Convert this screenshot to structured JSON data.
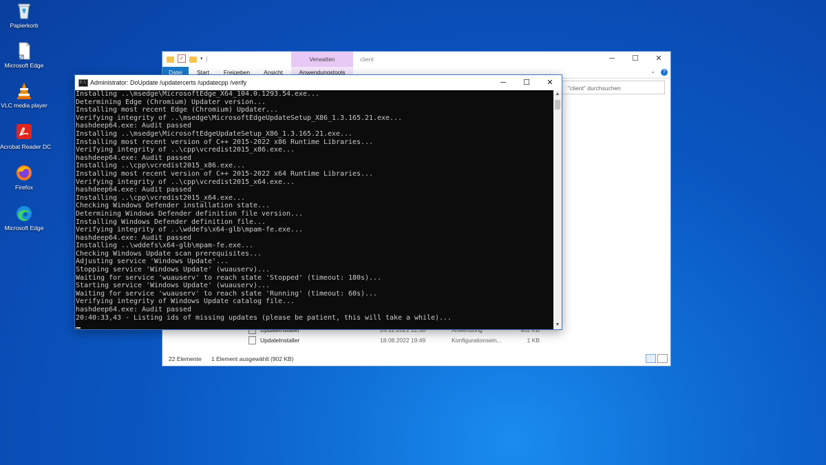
{
  "desktop": {
    "icons": [
      {
        "label": "Papierkorb",
        "icon": "recycle-bin-icon"
      },
      {
        "label": "Microsoft Edge",
        "icon": "file-shortcut-icon"
      },
      {
        "label": "VLC media player",
        "icon": "vlc-icon"
      },
      {
        "label": "Acrobat Reader DC",
        "icon": "acrobat-icon"
      },
      {
        "label": "Firefox",
        "icon": "firefox-icon"
      },
      {
        "label": "Microsoft Edge",
        "icon": "edge-icon"
      }
    ]
  },
  "explorer": {
    "context_tab": "Verwalten",
    "title": "client",
    "ribbon_tabs": [
      "Datei",
      "Start",
      "Freigeben",
      "Ansicht",
      "Anwendungstools"
    ],
    "search_placeholder": "\"client\" durchsuchen",
    "files": [
      {
        "name": "UpdateInstaller",
        "date": "24.12.2021 12:30",
        "type": "Anwendung",
        "size": "902 KB"
      },
      {
        "name": "UpdateInstaller",
        "date": "18.08.2022 19:49",
        "type": "Konfigurationsein...",
        "size": "1 KB"
      }
    ],
    "status_count": "22 Elemente",
    "status_selected": "1 Element ausgewählt (902 KB)"
  },
  "console": {
    "title": "Administrator:  DoUpdate /updatercerts /updatecpp /verify",
    "lines": [
      "Installing ..\\msedge\\MicrosoftEdge_X64_104.0.1293.54.exe...",
      "Determining Edge (Chromium) Updater version...",
      "Installing most recent Edge (Chromium) Updater...",
      "Verifying integrity of ..\\msedge\\MicrosoftEdgeUpdateSetup_X86_1.3.165.21.exe...",
      "hashdeep64.exe: Audit passed",
      "Installing ..\\msedge\\MicrosoftEdgeUpdateSetup_X86_1.3.165.21.exe...",
      "Installing most recent version of C++ 2015-2022 x86 Runtime Libraries...",
      "Verifying integrity of ..\\cpp\\vcredist2015_x86.exe...",
      "hashdeep64.exe: Audit passed",
      "Installing ..\\cpp\\vcredist2015_x86.exe...",
      "Installing most recent version of C++ 2015-2022 x64 Runtime Libraries...",
      "Verifying integrity of ..\\cpp\\vcredist2015_x64.exe...",
      "hashdeep64.exe: Audit passed",
      "Installing ..\\cpp\\vcredist2015_x64.exe...",
      "Checking Windows Defender installation state...",
      "Determining Windows Defender definition file version...",
      "Installing Windows Defender definition file...",
      "Verifying integrity of ..\\wddefs\\x64-glb\\mpam-fe.exe...",
      "hashdeep64.exe: Audit passed",
      "Installing ..\\wddefs\\x64-glb\\mpam-fe.exe...",
      "Checking Windows Update scan prerequisites...",
      "Adjusting service 'Windows Update'...",
      "Stopping service 'Windows Update' (wuauserv)...",
      "Waiting for service 'wuauserv' to reach state 'Stopped' (timeout: 180s)...",
      "Starting service 'Windows Update' (wuauserv)...",
      "Waiting for service 'wuauserv' to reach state 'Running' (timeout: 60s)...",
      "Verifying integrity of Windows Update catalog file...",
      "hashdeep64.exe: Audit passed",
      "20:40:33,43 - Listing ids of missing updates (please be patient, this will take a while)..."
    ]
  }
}
